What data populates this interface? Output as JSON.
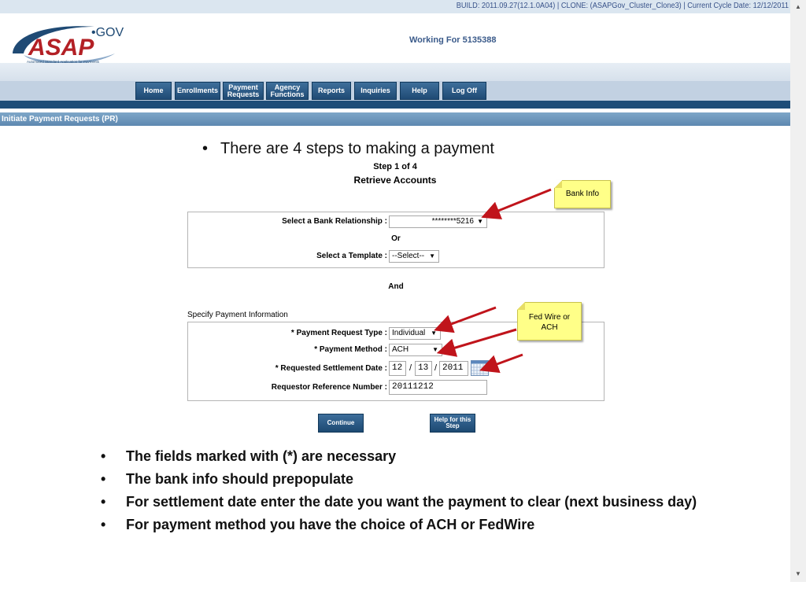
{
  "build_info": "BUILD: 2011.09.27(12.1.0A04) | CLONE: (ASAPGov_Cluster_Clone3) | Current Cycle Date: 12/12/2011",
  "logo": {
    "main": "ASAP",
    "suffix": "•GOV",
    "tagline": "Automated Standard Application for Payments"
  },
  "working_for": "Working For 5135388",
  "nav": [
    {
      "label": "Home"
    },
    {
      "label": "Enrollments"
    },
    {
      "label": "Payment\nRequests"
    },
    {
      "label": "Agency\nFunctions"
    },
    {
      "label": "Reports"
    },
    {
      "label": "Inquiries"
    },
    {
      "label": "Help"
    },
    {
      "label": "Log Off"
    }
  ],
  "page_title": "Initiate Payment Requests (PR)",
  "slide_top_bullet": "There are 4 steps to making a payment",
  "step": {
    "title": "Step 1 of 4",
    "subtitle": "Retrieve Accounts"
  },
  "retrieve": {
    "bank_label": "Select a Bank Relationship :",
    "bank_value": "********5216",
    "or_text": "Or",
    "template_label": "Select a Template :",
    "template_value": "--Select--"
  },
  "and_text": "And",
  "payment_info": {
    "section_title": "Specify Payment Information",
    "type_label": "* Payment Request Type :",
    "type_value": "Individual",
    "method_label": "* Payment Method :",
    "method_value": "ACH",
    "date_label": "* Requested Settlement Date :",
    "date_month": "12",
    "date_day": "13",
    "date_year": "2011",
    "date_sep": "/",
    "ref_label": "Requestor Reference Number :",
    "ref_value": "20111212"
  },
  "buttons": {
    "continue": "Continue",
    "help_step": "Help for this\nStep"
  },
  "callouts": {
    "bank_info": "Bank Info",
    "fed_wire": "Fed Wire or\nACH"
  },
  "bullets": [
    "The fields marked with (*) are necessary",
    "The bank info should prepopulate",
    "For settlement date enter the date you want the payment to clear (next business day)",
    "For payment method you have the choice of ACH or FedWire"
  ],
  "colors": {
    "nav_button": "#2b5a85",
    "arrow": "#c0141b",
    "callout": "#ffff88",
    "brand": "#1f4a74"
  }
}
